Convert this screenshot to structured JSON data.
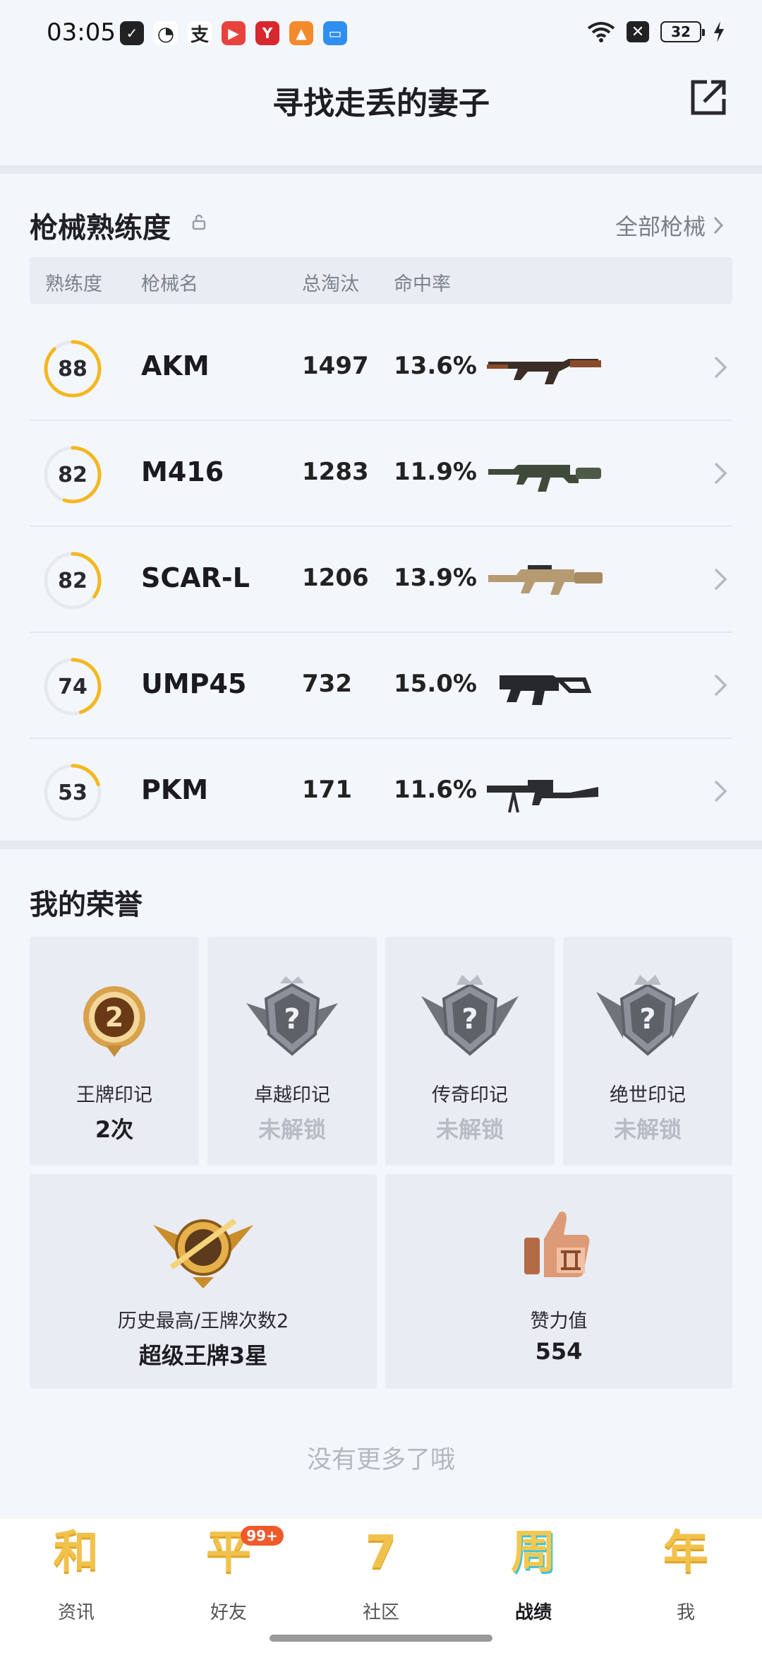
{
  "status_bar": {
    "time": "03:05",
    "battery": "32",
    "icons": [
      "shield-app-icon",
      "wechat-icon",
      "alipay-icon",
      "video-app-icon",
      "red-app-icon",
      "orange-app-icon",
      "blue-app-icon",
      "wifi-icon",
      "x-icon",
      "battery-icon",
      "charging-icon"
    ]
  },
  "header": {
    "title": "寻找走丢的妻子",
    "share_icon": "share-icon"
  },
  "weapons": {
    "title": "枪械熟练度",
    "all_link": "全部枪械",
    "columns": [
      "熟练度",
      "枪械名",
      "总淘汰",
      "命中率"
    ],
    "rows": [
      {
        "proficiency": "88",
        "name": "AKM",
        "kills": "1497",
        "accuracy": "13.6%",
        "progress": 0.88,
        "weapon_icon": "akm-rifle-icon"
      },
      {
        "proficiency": "82",
        "name": "M416",
        "kills": "1283",
        "accuracy": "11.9%",
        "progress": 0.55,
        "weapon_icon": "m416-rifle-icon"
      },
      {
        "proficiency": "82",
        "name": "SCAR-L",
        "kills": "1206",
        "accuracy": "13.9%",
        "progress": 0.35,
        "weapon_icon": "scar-l-rifle-icon"
      },
      {
        "proficiency": "74",
        "name": "UMP45",
        "kills": "732",
        "accuracy": "15.0%",
        "progress": 0.45,
        "weapon_icon": "ump45-smg-icon"
      },
      {
        "proficiency": "53",
        "name": "PKM",
        "kills": "171",
        "accuracy": "11.6%",
        "progress": 0.2,
        "weapon_icon": "pkm-mg-icon"
      }
    ]
  },
  "honors": {
    "title": "我的荣誉",
    "marks": [
      {
        "label": "王牌印记",
        "value": "2次",
        "locked": false,
        "icon": "ace-medal-icon"
      },
      {
        "label": "卓越印记",
        "value": "未解锁",
        "locked": true,
        "icon": "locked-badge-icon"
      },
      {
        "label": "传奇印记",
        "value": "未解锁",
        "locked": true,
        "icon": "locked-badge-icon"
      },
      {
        "label": "绝世印记",
        "value": "未解锁",
        "locked": true,
        "icon": "locked-badge-icon"
      }
    ],
    "highest": {
      "label": "历史最高/王牌次数2",
      "value": "超级王牌3星",
      "icon": "super-ace-emblem-icon"
    },
    "likes": {
      "label": "赞力值",
      "value": "554",
      "icon": "thumbs-up-icon"
    }
  },
  "no_more": "没有更多了哦",
  "bottom_nav": {
    "items": [
      {
        "glyph": "和",
        "label": "资讯",
        "active": false
      },
      {
        "glyph": "平",
        "label": "好友",
        "active": false,
        "badge": "99+"
      },
      {
        "glyph": "7",
        "label": "社区",
        "active": false
      },
      {
        "glyph": "周",
        "label": "战绩",
        "active": true
      },
      {
        "glyph": "年",
        "label": "我",
        "active": false
      }
    ]
  },
  "colors": {
    "ring": "#f4b71f",
    "ring_track": "#e6e9ee",
    "accent": "#f1c24b",
    "badge": "#f05a2a"
  }
}
